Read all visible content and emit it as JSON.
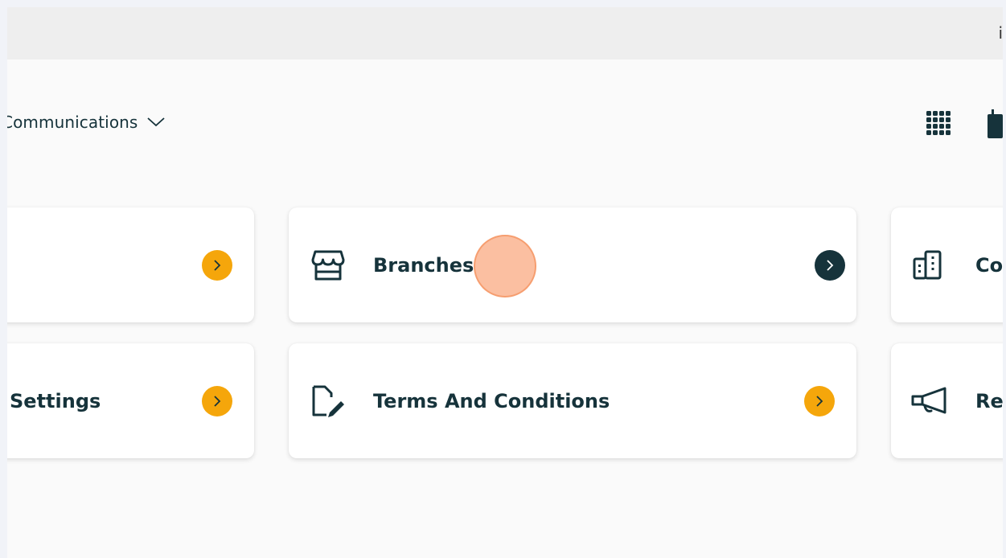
{
  "topbar": {
    "glyph": "i"
  },
  "nav": {
    "dropdown_label": "Communications"
  },
  "icons": {
    "apps": "grid-apps-icon",
    "calendar": "calendar-icon",
    "chevron": "chevron-down-icon",
    "arrow": "chevron-right-icon"
  },
  "colors": {
    "accent_yellow": "#f5a60b",
    "dark_teal": "#16333b",
    "click_marker": "#f9b48f"
  },
  "cards": {
    "row1_left": {
      "label": "",
      "arrow_color": "yellow"
    },
    "branches": {
      "label": "Branches",
      "icon": "store-icon",
      "arrow_color": "dark"
    },
    "row1_right": {
      "label": "Co",
      "icon": "buildings-icon"
    },
    "settings": {
      "label": "Settings",
      "arrow_color": "yellow"
    },
    "terms": {
      "label": "Terms And Conditions",
      "icon": "document-edit-icon",
      "arrow_color": "yellow"
    },
    "row2_right": {
      "label": "Re",
      "icon": "megaphone-icon"
    }
  }
}
